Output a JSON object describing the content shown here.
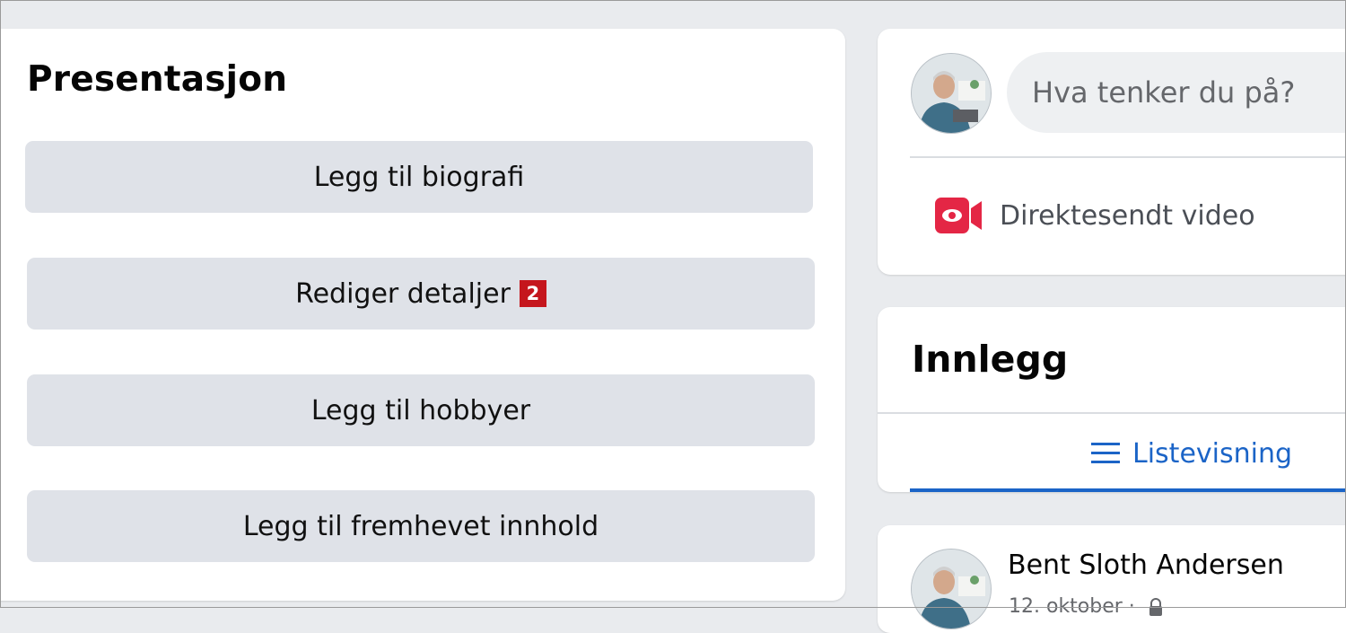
{
  "intro": {
    "title": "Presentasjon",
    "buttons": {
      "add_bio": "Legg til biografi",
      "edit_details": "Rediger detaljer",
      "edit_details_badge": "2",
      "add_hobbies": "Legg til hobbyer",
      "add_featured": "Legg til fremhevet innhold"
    }
  },
  "composer": {
    "placeholder": "Hva tenker du på?",
    "live_video_label": "Direktesendt video",
    "live_icon": "live-video-camera-icon",
    "live_color": "#e42645"
  },
  "posts": {
    "title": "Innlegg",
    "list_view_label": "Listevisning",
    "list_icon": "list-lines-icon",
    "accent_color": "#1b64c7"
  },
  "post": {
    "author": "Bent Sloth Andersen",
    "date": "12. oktober ·",
    "privacy_icon": "lock-icon"
  }
}
